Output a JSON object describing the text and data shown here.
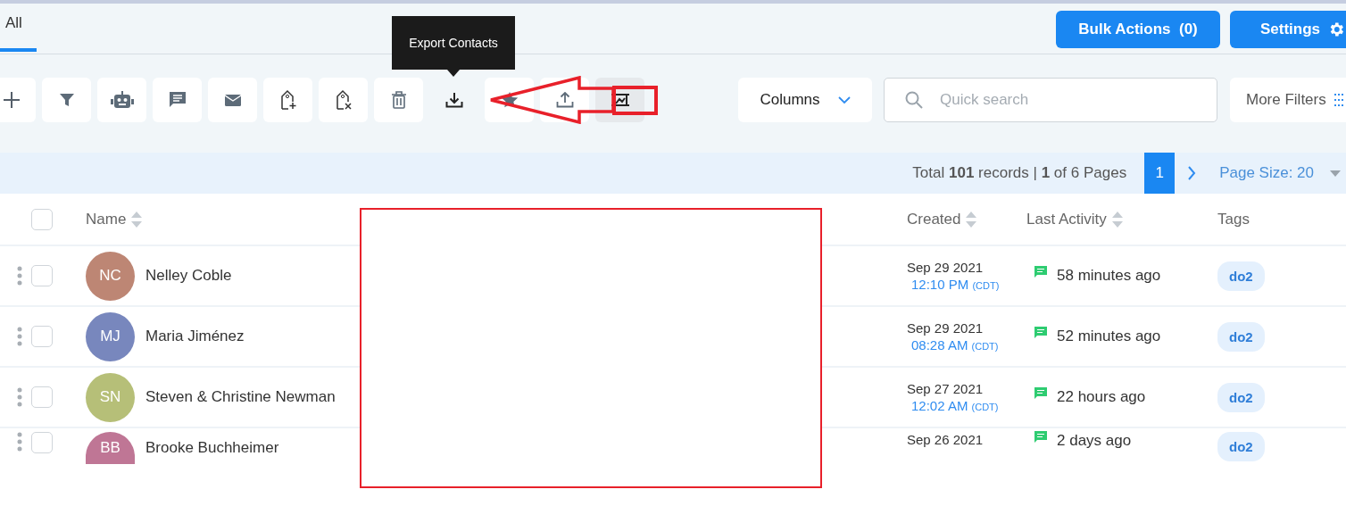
{
  "tabs": [
    {
      "label": "All",
      "selected": true
    }
  ],
  "header_buttons": [
    {
      "label": "Bulk Actions  (0)",
      "kind": "bulk"
    },
    {
      "label": "Settings",
      "kind": "settings"
    }
  ],
  "tools": [
    {
      "kind": "plus",
      "selected": false,
      "hovered": false
    },
    {
      "kind": "filter",
      "selected": false,
      "hovered": false
    },
    {
      "kind": "robot",
      "selected": false,
      "hovered": false
    },
    {
      "kind": "chat",
      "selected": false,
      "hovered": false
    },
    {
      "kind": "mail",
      "selected": false,
      "hovered": false
    },
    {
      "kind": "tag-add",
      "selected": false,
      "hovered": false
    },
    {
      "kind": "tag-remove",
      "selected": false,
      "hovered": false
    },
    {
      "kind": "trash",
      "selected": false,
      "hovered": false
    },
    {
      "kind": "download",
      "selected": false,
      "hovered": true,
      "tooltip": "Export Contacts"
    },
    {
      "kind": "star",
      "selected": false,
      "hovered": false
    },
    {
      "kind": "upload",
      "selected": false,
      "hovered": false
    },
    {
      "kind": "frame",
      "selected": true,
      "hovered": false
    }
  ],
  "columns_button": "Columns",
  "search": {
    "placeholder": "Quick search"
  },
  "more_filters": "More Filters",
  "pagination": {
    "summary": "Total **101** records | **1** of 6 Pages",
    "pages": [
      {
        "label": "1",
        "selected": true
      }
    ],
    "page_size": "Page Size: 20"
  },
  "table": {
    "select_all": {
      "checked": false
    },
    "columns": [
      {
        "label": "Name",
        "sortable": true
      },
      {
        "label": "Created",
        "sortable": true
      },
      {
        "label": "Last Activity",
        "sortable": true
      },
      {
        "label": "Tags",
        "sortable": false
      }
    ],
    "rows": [
      {
        "checked": false,
        "initials": "NC",
        "color": "#bd8674",
        "name": "Nelley Coble",
        "date": "Sep 29 2021",
        "time": "12:10 PM",
        "zone": "(CDT)",
        "activity": "58 minutes ago",
        "tag": "do2"
      },
      {
        "checked": false,
        "initials": "MJ",
        "color": "#7887bd",
        "name": "Maria Jiménez",
        "date": "Sep 29 2021",
        "time": "08:28 AM",
        "zone": "(CDT)",
        "activity": "52 minutes ago",
        "tag": "do2"
      },
      {
        "checked": false,
        "initials": "SN",
        "color": "#b6bf78",
        "name": "Steven & Christine Newman",
        "date": "Sep 27 2021",
        "time": "12:02 AM",
        "zone": "(CDT)",
        "activity": "22 hours ago",
        "tag": "do2"
      },
      {
        "checked": false,
        "initials": "BB",
        "color": "#bf7695",
        "name": "Brooke Buchheimer",
        "date": "Sep 26 2021",
        "activity": "2 days ago",
        "tag": "do2"
      }
    ]
  }
}
